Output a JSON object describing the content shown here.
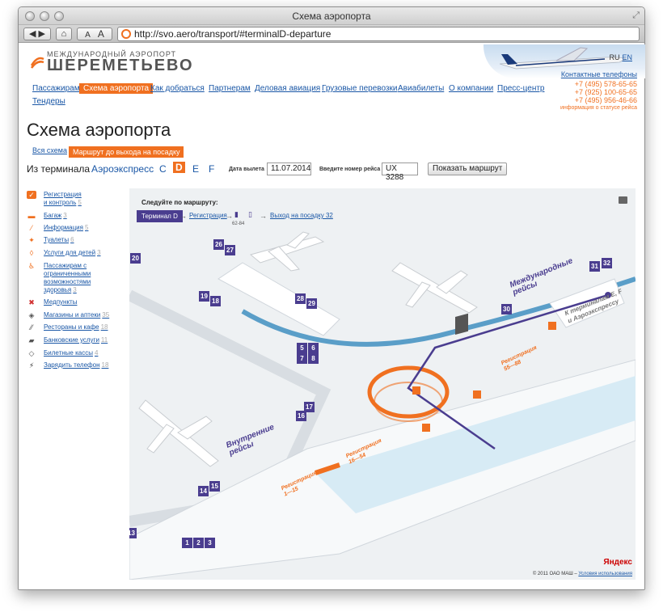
{
  "window": {
    "title": "Схема аэропорта",
    "url": "http://svo.aero/transport/#terminalD-departure",
    "font_small": "A",
    "font_large": "A"
  },
  "header": {
    "logo_top": "МЕЖДУНАРОДНЫЙ АЭРОПОРТ",
    "logo_bottom": "ШЕРЕМЕТЬЕВО",
    "lang_ru": "RU",
    "lang_en": "EN",
    "contacts_label": "Контактные телефоны",
    "phones": [
      "+7 (495) 578-65-65",
      "+7 (925) 100-65-65",
      "+7 (495) 956-46-66"
    ],
    "flight_status": "информация о статусе рейса"
  },
  "nav": {
    "items": [
      {
        "label": "Пассажирам",
        "active": false
      },
      {
        "label": "Схема аэропорта",
        "active": true
      },
      {
        "label": "Как добраться",
        "active": false
      },
      {
        "label": "Партнерам",
        "active": false
      },
      {
        "label": "Деловая авиация",
        "active": false
      },
      {
        "label": "Грузовые перевозки",
        "active": false
      },
      {
        "label": "Авиабилеты",
        "active": false
      },
      {
        "label": "О компании",
        "active": false
      },
      {
        "label": "Пресс-центр",
        "active": false
      },
      {
        "label": "Тендеры",
        "active": false
      }
    ]
  },
  "page": {
    "title": "Схема аэропорта",
    "tabs": [
      "Вся схема",
      "Маршрут до выхода на посадку"
    ]
  },
  "form": {
    "from_terminal_label": "Из терминала",
    "terminals": [
      "Аэроэкспресс",
      "C",
      "D",
      "E",
      "F"
    ],
    "active_terminal": "D",
    "date_label": "Дата вылета",
    "date_value": "11.07.2014",
    "flight_label": "Введите номер рейса",
    "flight_value": "UX 3288",
    "submit_label": "Показать маршрут"
  },
  "legend": {
    "items": [
      {
        "label": "Регистрация",
        "label2": "и контроль",
        "count": "5",
        "icon": "checkin-icon"
      },
      {
        "label": "Багаж",
        "count": "3",
        "icon": "baggage-icon"
      },
      {
        "label": "Информация",
        "count": "5",
        "icon": "info-icon"
      },
      {
        "label": "Туалеты",
        "count": "6",
        "icon": "toilet-icon"
      },
      {
        "label": "Услуги для детей",
        "count": "3",
        "icon": "kids-icon"
      },
      {
        "label": "Пассажирам с",
        "label2": "ограниченными",
        "label3": "возможностями",
        "label4": "здоровья",
        "count": "3",
        "icon": "disabled-icon"
      },
      {
        "label": "Медпункты",
        "count": "",
        "icon": "medical-icon"
      },
      {
        "label": "Магазины и аптеки",
        "count": "35",
        "icon": "shops-icon"
      },
      {
        "label": "Рестораны и кафе",
        "count": "18",
        "icon": "restaurant-icon"
      },
      {
        "label": "Банковские услуги",
        "count": "11",
        "icon": "bank-icon"
      },
      {
        "label": "Билетные кассы",
        "count": "4",
        "icon": "tickets-icon"
      },
      {
        "label": "Зарядить телефон",
        "count": "18",
        "icon": "charge-icon"
      }
    ]
  },
  "route": {
    "heading": "Следуйте по маршруту:",
    "start": "Терминал D",
    "step1": "Регистрация",
    "step1_sub": "62-84",
    "step2": "Выход на посадку 32",
    "arrow": "→"
  },
  "map": {
    "gates": [
      "20",
      "26",
      "27",
      "19",
      "18",
      "28",
      "29",
      "5",
      "6",
      "7",
      "8",
      "17",
      "16",
      "14",
      "15",
      "13",
      "1",
      "2",
      "3",
      "30",
      "31",
      "32"
    ],
    "labels": {
      "intl": [
        "Международные",
        "рейсы"
      ],
      "domestic": [
        "Внутренние",
        "рейсы"
      ],
      "to_terminals": [
        "К терминалам E, F",
        "и Аэроэкспрессу"
      ],
      "reg1": [
        "Регистрация",
        "1—15"
      ],
      "reg2": [
        "Регистрация",
        "16—54"
      ],
      "reg3": [
        "Регистрация",
        "55—88"
      ]
    },
    "yandex": "Яндекс",
    "copyright": "© 2011 ОАО МАШ –",
    "terms": "Условия использования"
  },
  "colors": {
    "accent": "#f07020",
    "link": "#1a57a6",
    "route": "#4a3d8f"
  }
}
